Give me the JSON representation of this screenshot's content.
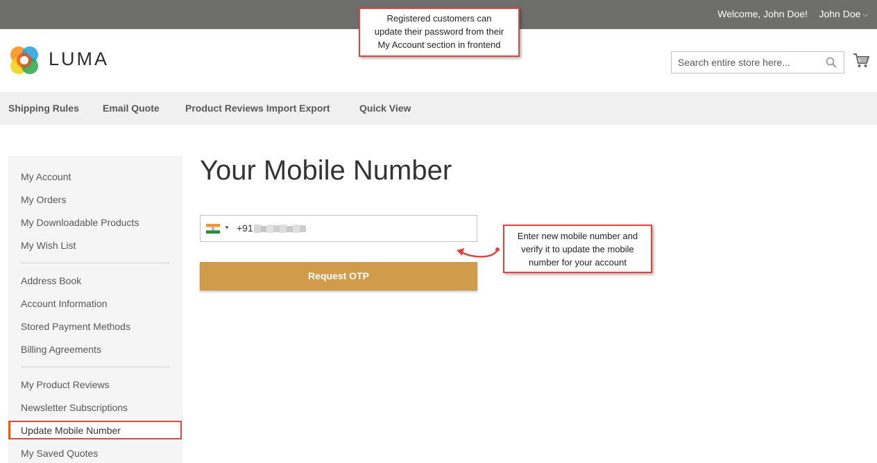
{
  "topbar": {
    "welcome": "Welcome, John Doe!",
    "account_name": "John Doe",
    "chevron_icon": "chevron-down-icon"
  },
  "header": {
    "logo_text": "LUMA",
    "search_placeholder": "Search entire store here...",
    "search_icon": "search-icon",
    "cart_icon": "cart-icon"
  },
  "nav": {
    "items": [
      {
        "label": "Shipping Rules"
      },
      {
        "label": "Email Quote"
      },
      {
        "label": "Product Reviews Import Export"
      },
      {
        "label": "Quick View"
      }
    ]
  },
  "sidebar": {
    "items": [
      {
        "label": "My Account"
      },
      {
        "label": "My Orders"
      },
      {
        "label": "My Downloadable Products"
      },
      {
        "label": "My Wish List"
      },
      {
        "label": "Address Book"
      },
      {
        "label": "Account Information"
      },
      {
        "label": "Stored Payment Methods"
      },
      {
        "label": "Billing Agreements"
      },
      {
        "label": "My Product Reviews"
      },
      {
        "label": "Newsletter Subscriptions"
      },
      {
        "label": "Update Mobile Number"
      },
      {
        "label": "My Saved Quotes"
      }
    ],
    "active": "Update Mobile Number"
  },
  "main": {
    "title": "Your Mobile Number",
    "phone": {
      "country": "India",
      "dial_code": "+91"
    },
    "request_otp_label": "Request OTP"
  },
  "callouts": {
    "top": [
      "Registered customers can",
      "update their password from their",
      "My Account section in frontend"
    ],
    "mid": [
      "Enter new mobile number and",
      "verify it to update the mobile",
      "number for your account"
    ]
  },
  "colors": {
    "topbar": "#6e6e6c",
    "button": "#d09c4b",
    "callout_border": "#e0443f",
    "active_accent": "#ff5501"
  }
}
